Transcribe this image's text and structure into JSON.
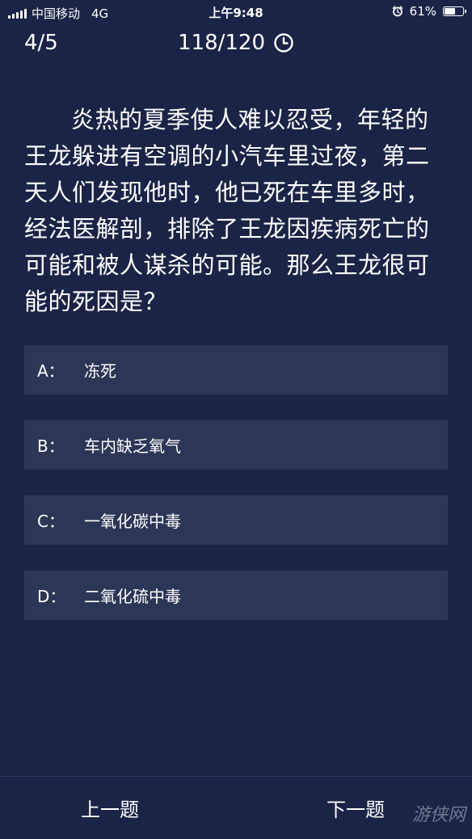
{
  "status_bar": {
    "carrier": "中国移动",
    "network": "4G",
    "time": "上午9:48",
    "battery": "61%",
    "battery_level": 0.61
  },
  "header": {
    "progress": "4/5",
    "timer": "118/120"
  },
  "question": {
    "text": "炎热的夏季使人难以忍受，年轻的王龙躲进有空调的小汽车里过夜，第二天人们发现他时，他已死在车里多时，经法医解剖，排除了王龙因疾病死亡的可能和被人谋杀的可能。那么王龙很可能的死因是？"
  },
  "options": [
    {
      "letter": "A：",
      "text": "冻死"
    },
    {
      "letter": "B：",
      "text": "车内缺乏氧气"
    },
    {
      "letter": "C：",
      "text": "一氧化碳中毒"
    },
    {
      "letter": "D：",
      "text": "二氧化硫中毒"
    }
  ],
  "nav": {
    "prev": "上一题",
    "next": "下一题"
  },
  "watermark": "游侠网",
  "icons": {
    "timer": "clock-icon",
    "alarm": "alarm-clock-icon",
    "signal": "signal-bars-icon",
    "battery": "battery-icon"
  },
  "colors": {
    "background": "#1b2446",
    "option_background": "#2d3657",
    "text": "#ffffff"
  }
}
